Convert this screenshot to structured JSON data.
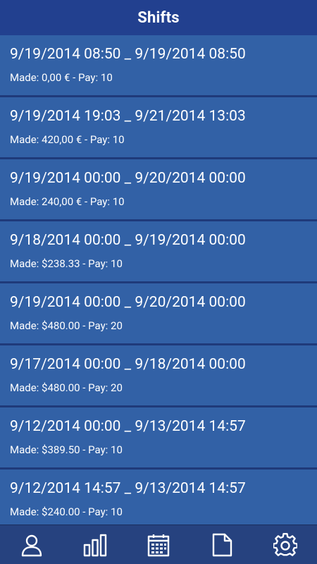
{
  "header": {
    "title": "Shifts"
  },
  "shifts": [
    {
      "range": "9/19/2014 08:50 _ 9/19/2014 08:50",
      "made": "Made: 0,00 € - Pay: 10"
    },
    {
      "range": "9/19/2014 19:03 _ 9/21/2014 13:03",
      "made": "Made: 420,00 € - Pay: 10"
    },
    {
      "range": "9/19/2014 00:00 _ 9/20/2014 00:00",
      "made": "Made: 240,00 € - Pay: 10"
    },
    {
      "range": "9/18/2014 00:00 _ 9/19/2014 00:00",
      "made": "Made: $238.33 - Pay: 10"
    },
    {
      "range": "9/19/2014 00:00 _ 9/20/2014 00:00",
      "made": "Made: $480.00 - Pay: 20"
    },
    {
      "range": "9/17/2014 00:00 _ 9/18/2014 00:00",
      "made": "Made: $480.00 - Pay: 20"
    },
    {
      "range": "9/12/2014 00:00 _ 9/13/2014 14:57",
      "made": "Made: $389.50 - Pay: 10"
    },
    {
      "range": "9/12/2014 14:57 _ 9/13/2014 14:57",
      "made": "Made: $240.00 - Pay: 10"
    }
  ],
  "tabs": [
    {
      "icon": "person-icon"
    },
    {
      "icon": "bar-chart-icon"
    },
    {
      "icon": "calendar-icon"
    },
    {
      "icon": "document-icon"
    },
    {
      "icon": "gear-icon"
    }
  ],
  "colors": {
    "header_bg": "#22408f",
    "item_bg": "#3261a6",
    "separator": "#1f3a7a",
    "tabbar_bg": "#26427f",
    "text": "#ffffff"
  }
}
